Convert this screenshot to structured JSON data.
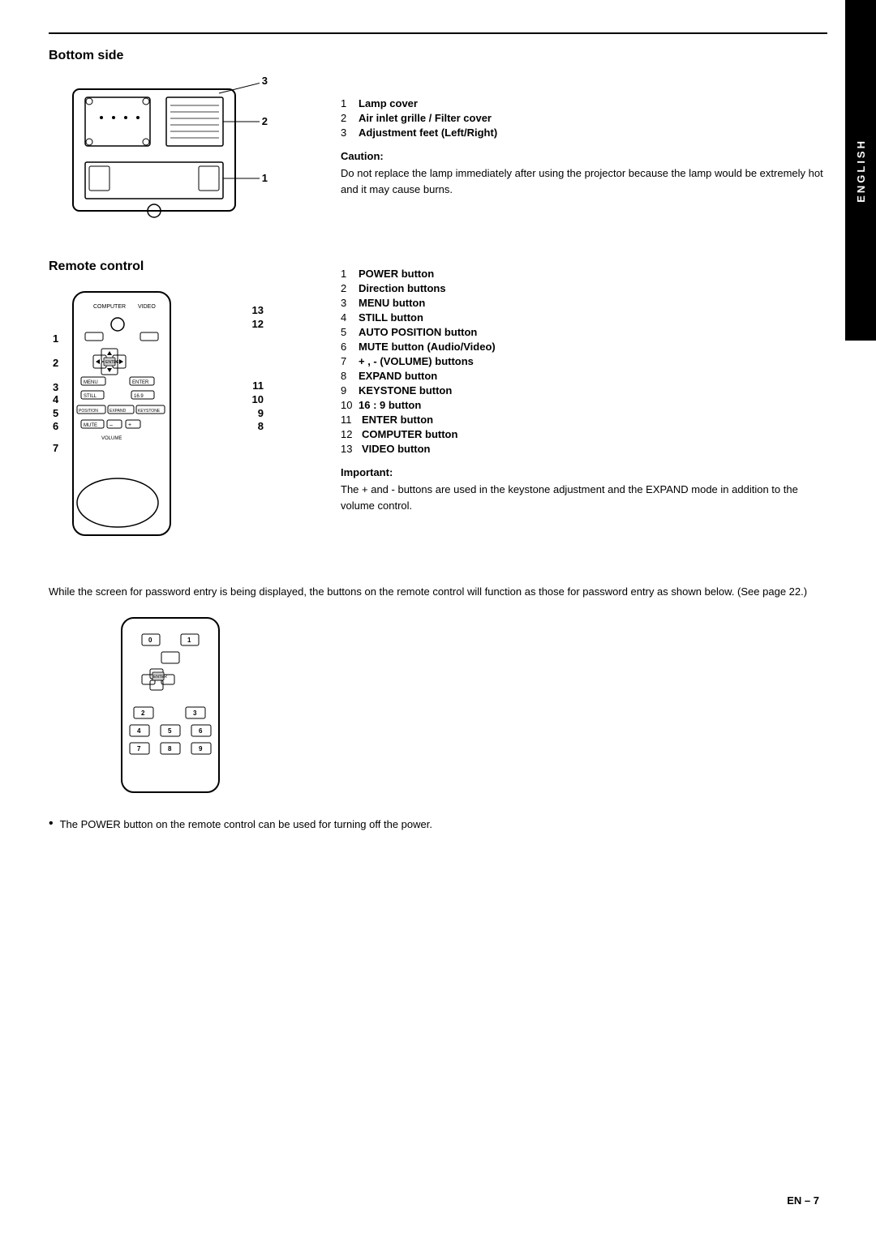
{
  "page": {
    "side_tab": "ENGLISH",
    "page_number": "EN – 7"
  },
  "bottom_side": {
    "title": "Bottom side",
    "labels": {
      "1": "1",
      "2": "2",
      "3": "3"
    },
    "items": [
      {
        "num": "1",
        "label": "Lamp cover"
      },
      {
        "num": "2",
        "label": "Air inlet grille / Filter cover"
      },
      {
        "num": "3",
        "label": "Adjustment feet (Left/Right)"
      }
    ],
    "caution_title": "Caution:",
    "caution_text": "Do not replace the lamp immediately after using the projector because the lamp would be extremely hot and it may cause burns."
  },
  "remote_control": {
    "title": "Remote control",
    "labels": {
      "1": "1",
      "2": "2",
      "3": "3",
      "4": "4",
      "5": "5",
      "6": "6",
      "7": "7",
      "8": "8",
      "9": "9",
      "10": "10",
      "11": "11",
      "12": "12",
      "13": "13"
    },
    "items": [
      {
        "num": "1",
        "label": "POWER button"
      },
      {
        "num": "2",
        "label": "Direction buttons"
      },
      {
        "num": "3",
        "label": "MENU button"
      },
      {
        "num": "4",
        "label": "STILL button"
      },
      {
        "num": "5",
        "label": "AUTO POSITION button"
      },
      {
        "num": "6",
        "label": "MUTE button (Audio/Video)"
      },
      {
        "num": "7",
        "label": "+ , - (VOLUME) buttons"
      },
      {
        "num": "8",
        "label": "EXPAND button"
      },
      {
        "num": "9",
        "label": "KEYSTONE button"
      },
      {
        "num": "10",
        "label": "16 : 9 button"
      },
      {
        "num": "11",
        "label": "ENTER button"
      },
      {
        "num": "12",
        "label": "COMPUTER button"
      },
      {
        "num": "13",
        "label": "VIDEO button"
      }
    ],
    "important_title": "Important:",
    "important_text": "The + and - buttons are used in the keystone adjustment and the EXPAND mode in addition to the volume control."
  },
  "password_section": {
    "text": "While the screen for password entry is being displayed, the buttons on the remote control will function as those for password entry as shown below. (See page 22.)"
  },
  "bullet": {
    "text": "The POWER button on the remote control can be used for turning off the power."
  }
}
